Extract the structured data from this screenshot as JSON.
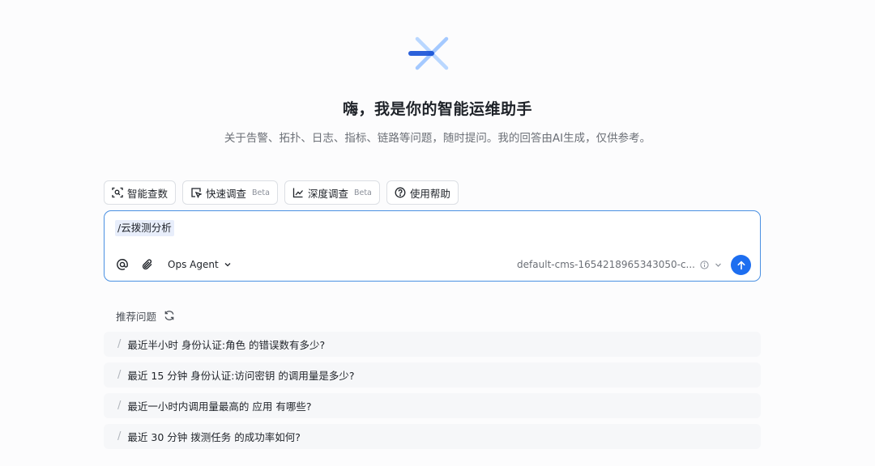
{
  "header": {
    "greeting": "嗨，我是你的智能运维助手",
    "subtitle": "关于告警、拓扑、日志、指标、链路等问题，随时提问。我的回答由AI生成，仅供参考。"
  },
  "modes": [
    {
      "label": "智能查数",
      "beta": ""
    },
    {
      "label": "快速调查",
      "beta": "Beta"
    },
    {
      "label": "深度调查",
      "beta": "Beta"
    },
    {
      "label": "使用帮助",
      "beta": ""
    }
  ],
  "composer": {
    "text": "/云拨测分析",
    "agent": "Ops Agent",
    "workspace": "default-cms-1654218965343050-c..."
  },
  "recommended": {
    "title": "推荐问题",
    "items": [
      "最近半小时 身份认证:角色 的错误数有多少?",
      "最近 15 分钟 身份认证:访问密钥 的调用量是多少?",
      "最近一小时内调用量最高的 应用 有哪些?",
      "最近 30 分钟 拨测任务 的成功率如何?"
    ]
  },
  "colors": {
    "accent": "#1d6ef0",
    "border_active": "#4a90e2",
    "chip_bg": "#e8eefb"
  }
}
